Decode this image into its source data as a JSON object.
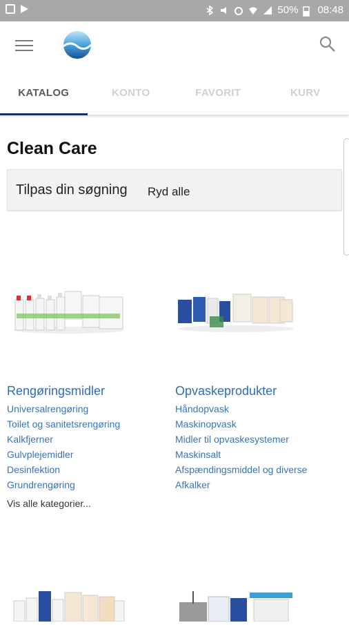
{
  "status_bar": {
    "battery": "50%",
    "time": "08:48"
  },
  "tabs": [
    {
      "label": "KATALOG",
      "active": true
    },
    {
      "label": "KONTO",
      "active": false
    },
    {
      "label": "FAVORIT",
      "active": false
    },
    {
      "label": "KURV",
      "active": false
    }
  ],
  "page_title": "Clean Care",
  "filter": {
    "label": "Tilpas din søgning",
    "clear_all": "Ryd alle"
  },
  "categories": [
    {
      "title": "Rengøringsmidler",
      "links": [
        "Universalrengøring",
        "Toilet og sanitetsrengøring",
        "Kalkfjerner",
        "Gulvplejemidler",
        "Desinfektion",
        "Grundrengøring"
      ],
      "view_all": "Vis alle kategorier..."
    },
    {
      "title": "Opvaskeprodukter",
      "links": [
        "Håndopvask",
        "Maskinopvask",
        "Midler til opvaskesystemer",
        "Maskinsalt",
        "Afspændingsmiddel og diverse",
        "Afkalker"
      ]
    }
  ],
  "colors": {
    "accent": "#1b2c6b",
    "link": "#3a73b8",
    "status_bar": "#a8a8a8"
  }
}
